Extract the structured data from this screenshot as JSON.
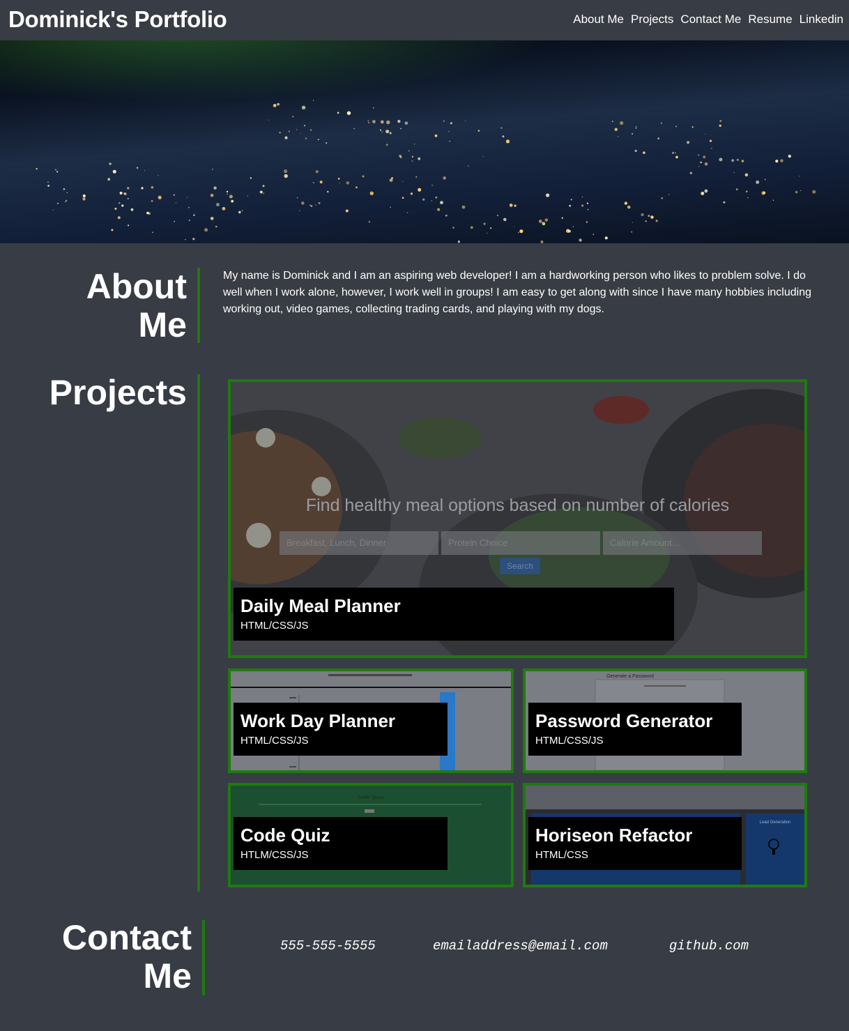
{
  "header": {
    "brand": "Dominick's Portfolio",
    "nav": [
      "About Me",
      "Projects",
      "Contact Me",
      "Resume",
      "Linkedin"
    ]
  },
  "about": {
    "title_line1": "About",
    "title_line2": "Me",
    "text": "My name is Dominick and I am an aspiring web developer! I am a hardworking person who likes to problem solve. I do well when I work alone, however, I work well in groups! I am easy to get along with since I have many hobbies including working out, video games, collecting trading cards, and playing with my dogs."
  },
  "projects": {
    "title": "Projects",
    "items": [
      {
        "name": "Daily Meal Planner",
        "tech": "HTML/CSS/JS",
        "shot": {
          "heading": "Find healthy meal options based on number of calories",
          "field1": "Breakfast, Lunch, Dinner",
          "field2": "Protein Choice",
          "field3": "Calorie Amount...",
          "button": "Search"
        }
      },
      {
        "name": "Work Day Planner",
        "tech": "HTML/CSS/JS"
      },
      {
        "name": "Password Generator",
        "tech": "HTML/CSS/JS",
        "shot": {
          "heading": "Generate a Password"
        }
      },
      {
        "name": "Code Quiz",
        "tech": "HTLM/CSS/JS",
        "shot": {
          "heading": "Code Quiz"
        }
      },
      {
        "name": "Horiseon Refactor",
        "tech": "HTML/CSS",
        "shot": {
          "heading": "Lead Generation"
        }
      }
    ]
  },
  "contact": {
    "title_line1": "Contact",
    "title_line2": "Me",
    "phone": "555-555-5555",
    "email": "emailaddress@email.com",
    "github": "github.com"
  },
  "colors": {
    "background": "#383c44",
    "accent_border": "#1f7a10",
    "label_bg": "#000000"
  }
}
